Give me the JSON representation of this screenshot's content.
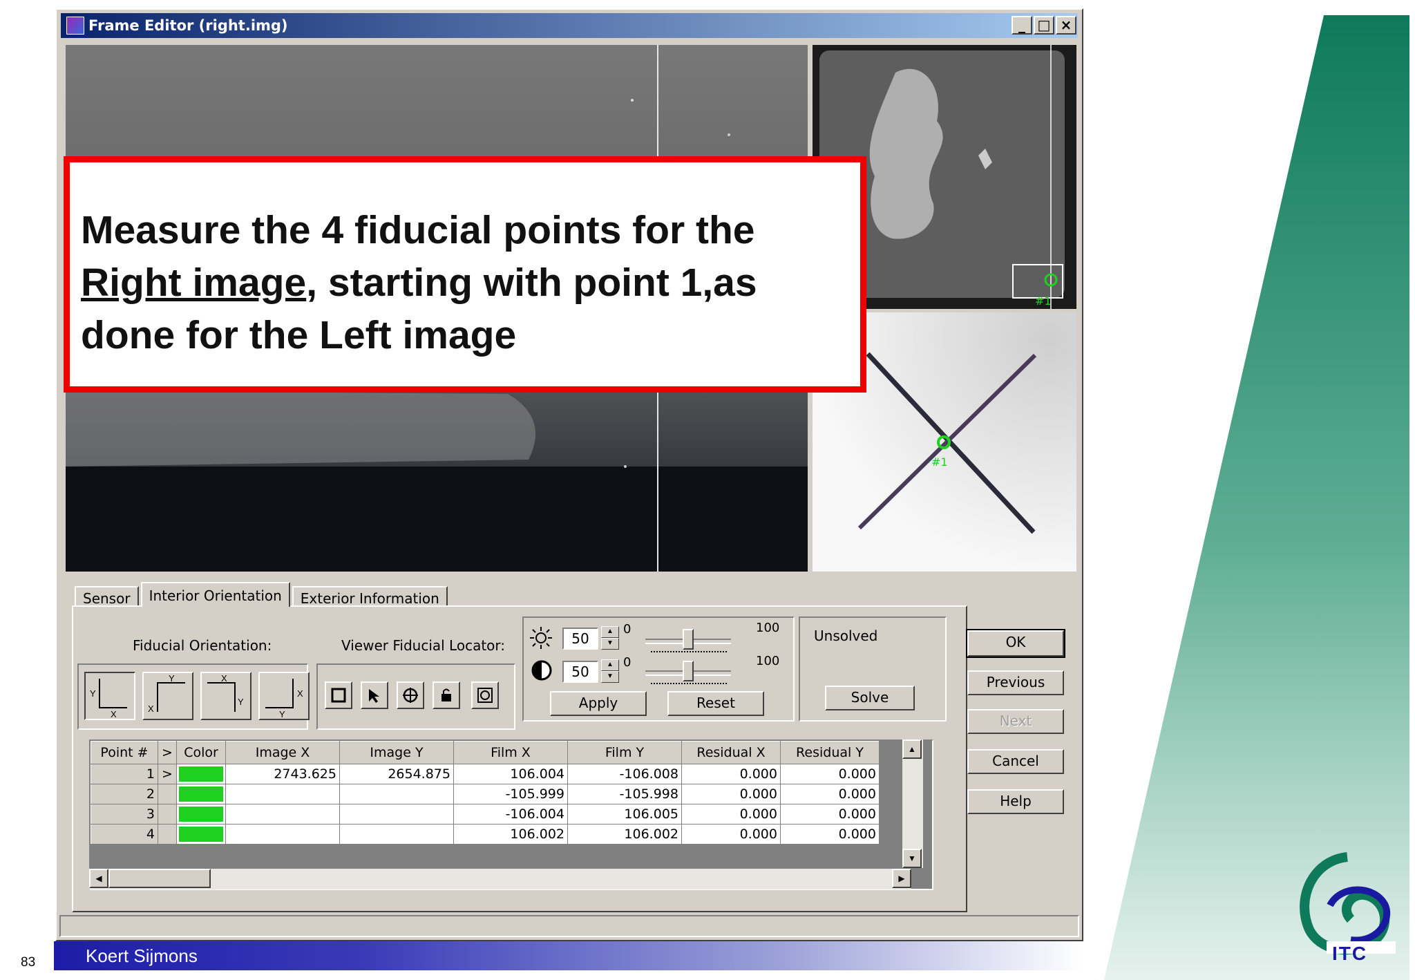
{
  "window": {
    "title": "Frame Editor (right.img)"
  },
  "window_buttons": {
    "minimize": "_",
    "maximize": "□",
    "close": "×"
  },
  "callout": {
    "line1": "Measure the 4 fiducial points for the",
    "line2_underlined": "Right image",
    "line2_rest": ", starting with point 1,as",
    "line3": "done for the Left image"
  },
  "zoom_marker": "#1",
  "overview_marker": "#1",
  "tabs": [
    {
      "label": "Sensor",
      "active": false
    },
    {
      "label": "Interior Orientation",
      "active": true
    },
    {
      "label": "Exterior Information",
      "active": false
    }
  ],
  "fiducial_orientation_label": "Fiducial Orientation:",
  "viewer_locator_label": "Viewer Fiducial Locator:",
  "brightness": {
    "value": "50",
    "min": "0",
    "max": "100",
    "level_percent": 50
  },
  "contrast": {
    "value": "50",
    "min": "0",
    "max": "100",
    "level_percent": 50
  },
  "buttons": {
    "apply": "Apply",
    "reset": "Reset",
    "solve": "Solve",
    "ok": "OK",
    "previous": "Previous",
    "next": "Next",
    "cancel": "Cancel",
    "help": "Help"
  },
  "status_text": "Unsolved",
  "table": {
    "headers": [
      "Point #",
      ">",
      "Color",
      "Image X",
      "Image Y",
      "Film X",
      "Film Y",
      "Residual X",
      "Residual Y"
    ],
    "rows": [
      {
        "point": "1",
        "sel": ">",
        "color": "#1fd01f",
        "image_x": "2743.625",
        "image_y": "2654.875",
        "film_x": "106.004",
        "film_y": "-106.008",
        "res_x": "0.000",
        "res_y": "0.000"
      },
      {
        "point": "2",
        "sel": "",
        "color": "#1fd01f",
        "image_x": "",
        "image_y": "",
        "film_x": "-105.999",
        "film_y": "-105.998",
        "res_x": "0.000",
        "res_y": "0.000"
      },
      {
        "point": "3",
        "sel": "",
        "color": "#1fd01f",
        "image_x": "",
        "image_y": "",
        "film_x": "-106.004",
        "film_y": "106.005",
        "res_x": "0.000",
        "res_y": "0.000"
      },
      {
        "point": "4",
        "sel": "",
        "color": "#1fd01f",
        "image_x": "",
        "image_y": "",
        "film_x": "106.002",
        "film_y": "106.002",
        "res_x": "0.000",
        "res_y": "0.000"
      }
    ]
  },
  "footer": {
    "author": "Koert Sijmons",
    "page": "83",
    "logo_text": "ITC"
  },
  "colors": {
    "callout_border": "#ee0000",
    "point_color": "#1fd01f",
    "footer_blue": "#1c1ca8",
    "itc_green": "#0e7a5a"
  }
}
